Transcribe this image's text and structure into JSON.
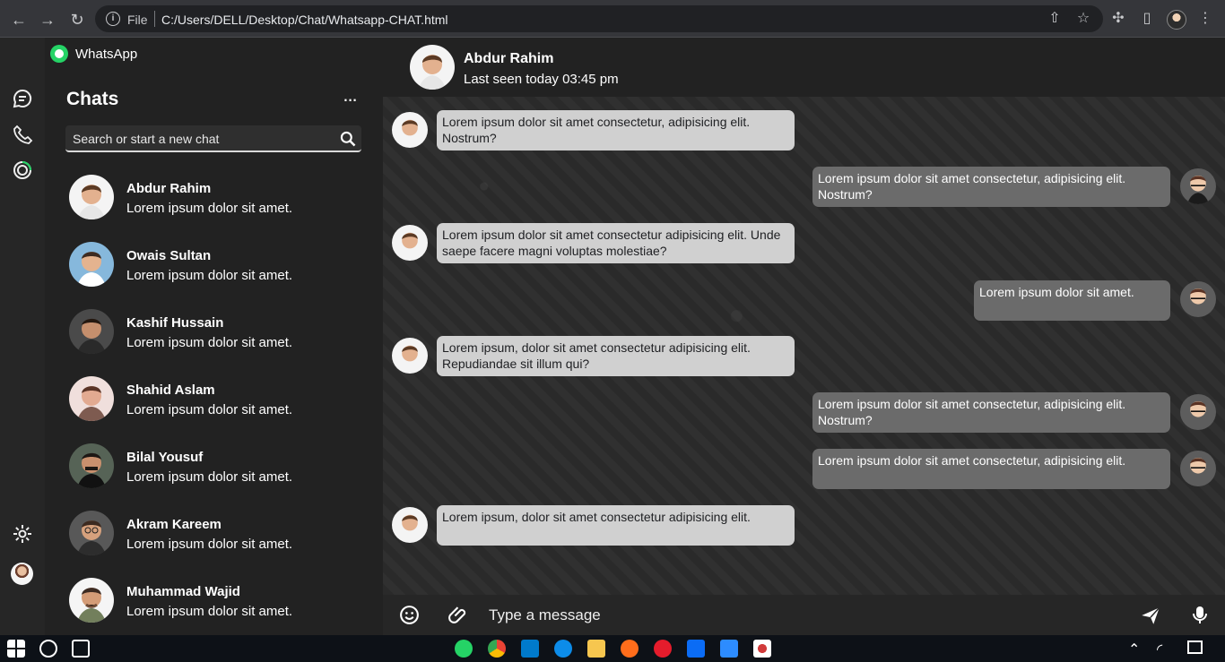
{
  "browser": {
    "file_label": "File",
    "url": "C:/Users/DELL/Desktop/Chat/Whatsapp-CHAT.html"
  },
  "sidebar": {
    "app_title": "WhatsApp",
    "chats_title": "Chats",
    "search_placeholder": "Search or start a new chat",
    "contacts": [
      {
        "name": "Abdur Rahim",
        "preview": "Lorem ipsum dolor sit amet."
      },
      {
        "name": "Owais Sultan",
        "preview": "Lorem ipsum dolor sit amet."
      },
      {
        "name": "Kashif Hussain",
        "preview": "Lorem ipsum dolor sit amet."
      },
      {
        "name": "Shahid Aslam",
        "preview": "Lorem ipsum dolor sit amet."
      },
      {
        "name": "Bilal Yousuf",
        "preview": "Lorem ipsum dolor sit amet."
      },
      {
        "name": "Akram Kareem",
        "preview": "Lorem ipsum dolor sit amet."
      },
      {
        "name": "Muhammad Wajid",
        "preview": "Lorem ipsum dolor sit amet."
      }
    ]
  },
  "chat": {
    "contact_name": "Abdur Rahim",
    "last_seen": "Last seen today 03:45 pm",
    "messages": [
      {
        "direction": "in",
        "text": "Lorem ipsum dolor sit amet consectetur, adipisicing elit. Nostrum?"
      },
      {
        "direction": "out",
        "text": "Lorem ipsum dolor sit amet consectetur, adipisicing elit. Nostrum?"
      },
      {
        "direction": "in",
        "text": "Lorem ipsum dolor sit amet consectetur adipisicing elit. Unde saepe facere magni voluptas molestiae?"
      },
      {
        "direction": "out",
        "text": "Lorem ipsum dolor sit amet."
      },
      {
        "direction": "in",
        "text": "Lorem ipsum, dolor sit amet consectetur adipisicing elit. Repudiandae sit illum qui?"
      },
      {
        "direction": "out",
        "text": "Lorem ipsum dolor sit amet consectetur, adipisicing elit. Nostrum?"
      },
      {
        "direction": "out",
        "text": "Lorem ipsum dolor sit amet consectetur, adipisicing elit."
      },
      {
        "direction": "in",
        "text": "Lorem ipsum, dolor sit amet consectetur adipisicing elit."
      }
    ],
    "composer_placeholder": "Type a message"
  },
  "icons": {
    "browser": [
      "back-icon",
      "forward-icon",
      "reload-icon",
      "info-icon",
      "share-icon",
      "star-icon",
      "extensions-icon",
      "side-panel-icon",
      "menu-icon"
    ],
    "rail": [
      "chat-icon",
      "phone-icon",
      "status-icon",
      "settings-icon"
    ],
    "composer": [
      "emoji-icon",
      "attach-icon",
      "send-icon",
      "microphone-icon"
    ]
  },
  "colors": {
    "accent": "#25d366",
    "incoming_bubble": "#d0d0d0",
    "outgoing_bubble": "#6b6b6b"
  }
}
